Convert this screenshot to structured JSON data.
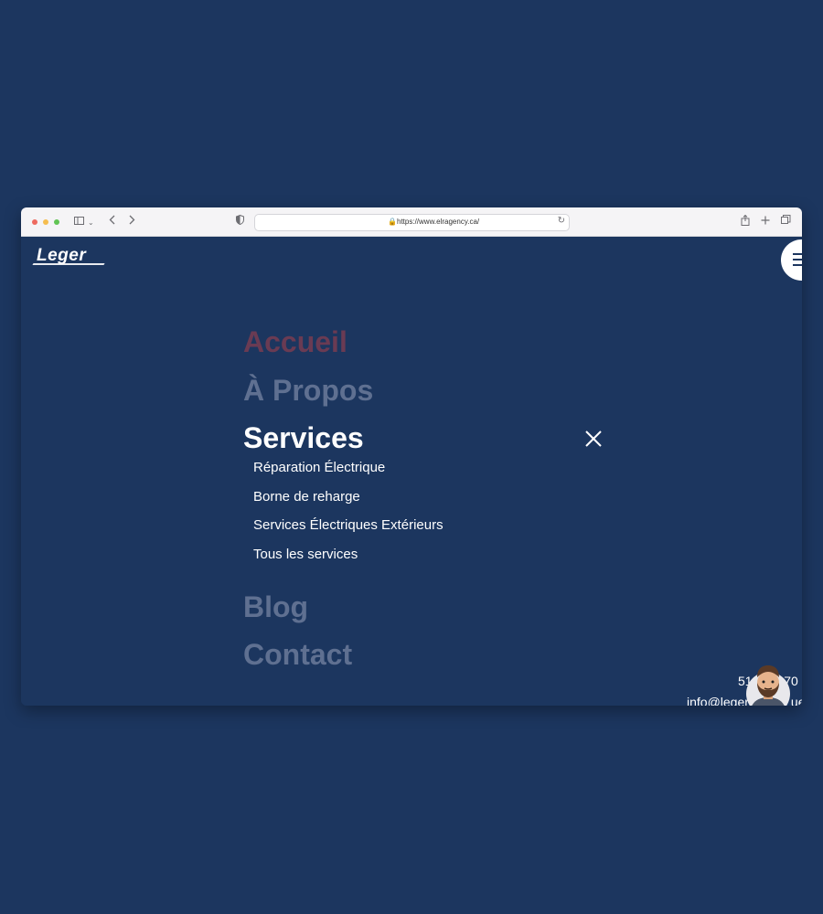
{
  "browser": {
    "url": "https://www.elragency.ca/"
  },
  "site": {
    "logo_text": "Leger"
  },
  "menu": {
    "items": [
      {
        "label": "Accueil",
        "state": "hover"
      },
      {
        "label": "À Propos",
        "state": "default"
      },
      {
        "label": "Services",
        "state": "active"
      },
      {
        "label": "Blog",
        "state": "default"
      },
      {
        "label": "Contact",
        "state": "default"
      }
    ],
    "services_submenu": [
      "Réparation Électrique",
      "Borne de reharge",
      "Services Électriques Extérieurs",
      "Tous les services"
    ]
  },
  "contact": {
    "phone": "51",
    "phone_tail": "-70",
    "email": "info@leger",
    "email_tail": "ue"
  },
  "colors": {
    "background": "#1c365f",
    "accent_hover": "#6a3b53",
    "muted": "#5f7091",
    "text": "#ffffff"
  },
  "icons": [
    "sidebar-icon",
    "chevron-left-icon",
    "chevron-right-icon",
    "shield-icon",
    "lock-icon",
    "reload-icon",
    "share-icon",
    "plus-icon",
    "tabs-icon",
    "hamburger-icon",
    "close-icon",
    "avatar"
  ]
}
